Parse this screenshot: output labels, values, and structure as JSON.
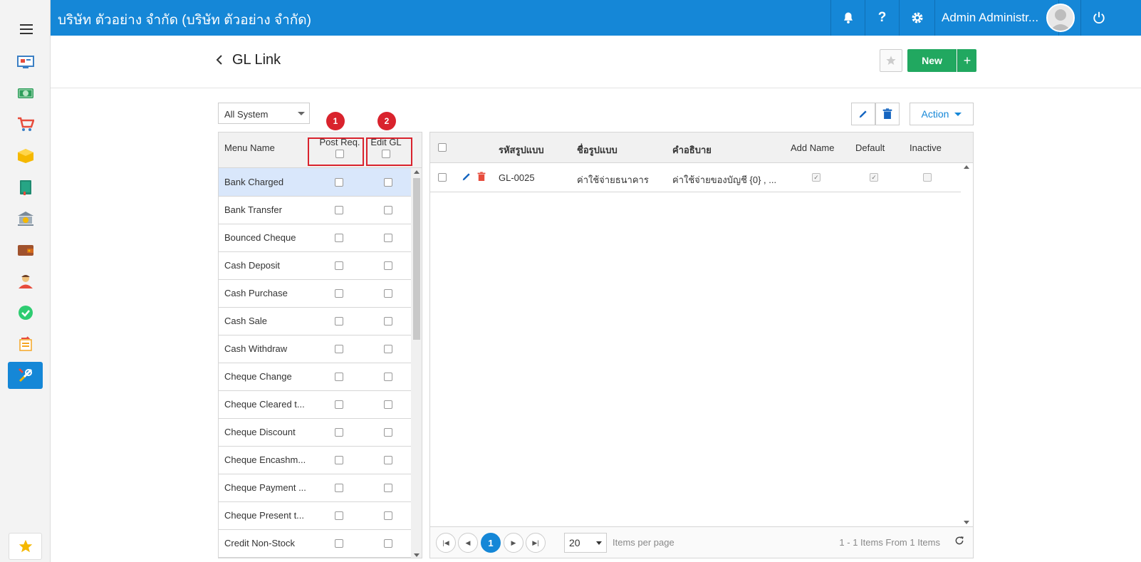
{
  "app": {
    "company": "บริษัท ตัวอย่าง จำกัด (บริษัท ตัวอย่าง จำกัด)",
    "user": "Admin Administr...",
    "accent": "#1587d7"
  },
  "sidebar": {
    "items": [
      {
        "icon": "dashboard-icon"
      },
      {
        "icon": "money-icon"
      },
      {
        "icon": "cart-icon"
      },
      {
        "icon": "box-icon"
      },
      {
        "icon": "book-icon"
      },
      {
        "icon": "bank-icon"
      },
      {
        "icon": "wallet-icon"
      },
      {
        "icon": "people-icon"
      },
      {
        "icon": "check-icon"
      },
      {
        "icon": "transfer-icon"
      },
      {
        "icon": "tools-icon",
        "active": true
      }
    ],
    "favorite_icon": "star-icon"
  },
  "header": {
    "title": "GL Link",
    "new_label": "New",
    "plus_label": "+"
  },
  "filter": {
    "system": "All System"
  },
  "left_table": {
    "columns": {
      "name": "Menu Name",
      "post": "Post Req.",
      "edit": "Edit GL"
    },
    "badges": {
      "post": "1",
      "edit": "2"
    },
    "rows": [
      "Bank Charged",
      "Bank Transfer",
      "Bounced Cheque",
      "Cash Deposit",
      "Cash Purchase",
      "Cash Sale",
      "Cash Withdraw",
      "Cheque Change",
      "Cheque Cleared t...",
      "Cheque Discount",
      "Cheque Encashm...",
      "Cheque Payment ...",
      "Cheque Present t...",
      "Credit Non-Stock"
    ]
  },
  "toolbar": {
    "action_label": "Action"
  },
  "grid": {
    "columns": {
      "code": "รหัสรูปแบบ",
      "name": "ชื่อรูปแบบ",
      "desc": "คำอธิบาย",
      "add_name": "Add Name",
      "default": "Default",
      "inactive": "Inactive"
    },
    "rows": [
      {
        "code": "GL-0025",
        "name": "ค่าใช้จ่ายธนาคาร",
        "desc": "ค่าใช้จ่ายของบัญชี {0} , ...",
        "add_name": true,
        "default": true,
        "inactive": false
      }
    ]
  },
  "pager": {
    "current_page": "1",
    "page_size": "20",
    "items_per_page": "Items per page",
    "info": "1 - 1 Items From 1 Items"
  }
}
